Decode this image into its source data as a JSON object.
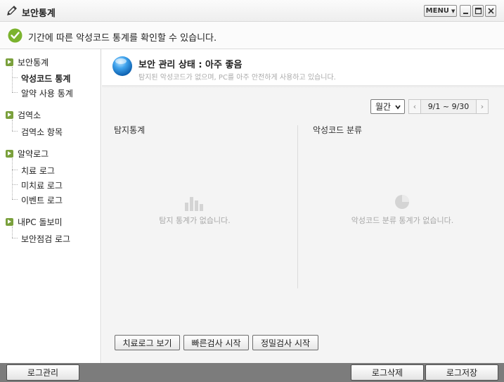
{
  "window": {
    "title": "보안통계",
    "menu_label": "MENU",
    "icons": {
      "app": "pencil-icon",
      "minimize": "minimize-icon",
      "maximize": "maximize-icon",
      "close": "close-icon"
    }
  },
  "notice": {
    "text": "기간에 따른 악성코드 통계를 확인할 수 있습니다.",
    "icon": "check-circle-icon"
  },
  "sidebar": {
    "groups": [
      {
        "label": "보안통계",
        "items": [
          {
            "label": "악성코드 통계",
            "active": true
          },
          {
            "label": "알약 사용 통계",
            "active": false
          }
        ]
      },
      {
        "label": "검역소",
        "items": [
          {
            "label": "검역소 항목",
            "active": false
          }
        ]
      },
      {
        "label": "알약로그",
        "items": [
          {
            "label": "치료 로그",
            "active": false
          },
          {
            "label": "미치료 로그",
            "active": false
          },
          {
            "label": "이벤트 로그",
            "active": false
          }
        ]
      },
      {
        "label": "내PC 돌보미",
        "items": [
          {
            "label": "보안점검 로그",
            "active": false
          }
        ]
      }
    ]
  },
  "status": {
    "title": "보안 관리 상태 : 아주 좋음",
    "description": "탐지된 악성코드가 없으며, PC를 아주 안전하게 사용하고 있습니다.",
    "icon": "status-orb-icon"
  },
  "filters": {
    "period_selected": "월간",
    "date_range": "9/1 ~ 9/30"
  },
  "panels": {
    "detection": {
      "title": "탐지통계",
      "empty_text": "탐지 통계가 없습니다."
    },
    "classification": {
      "title": "악성코드 분류",
      "empty_text": "악성코드 분류 통계가 없습니다."
    }
  },
  "actions": {
    "view_treatment_log": "치료로그 보기",
    "quick_scan": "빠른검사 시작",
    "full_scan": "정밀검사 시작"
  },
  "footer": {
    "log_manage": "로그관리",
    "log_delete": "로그삭제",
    "log_save": "로그저장"
  },
  "colors": {
    "accent_green": "#7aa03c",
    "status_blue": "#2b8fd8",
    "footer_gray": "#7c7c7c"
  }
}
